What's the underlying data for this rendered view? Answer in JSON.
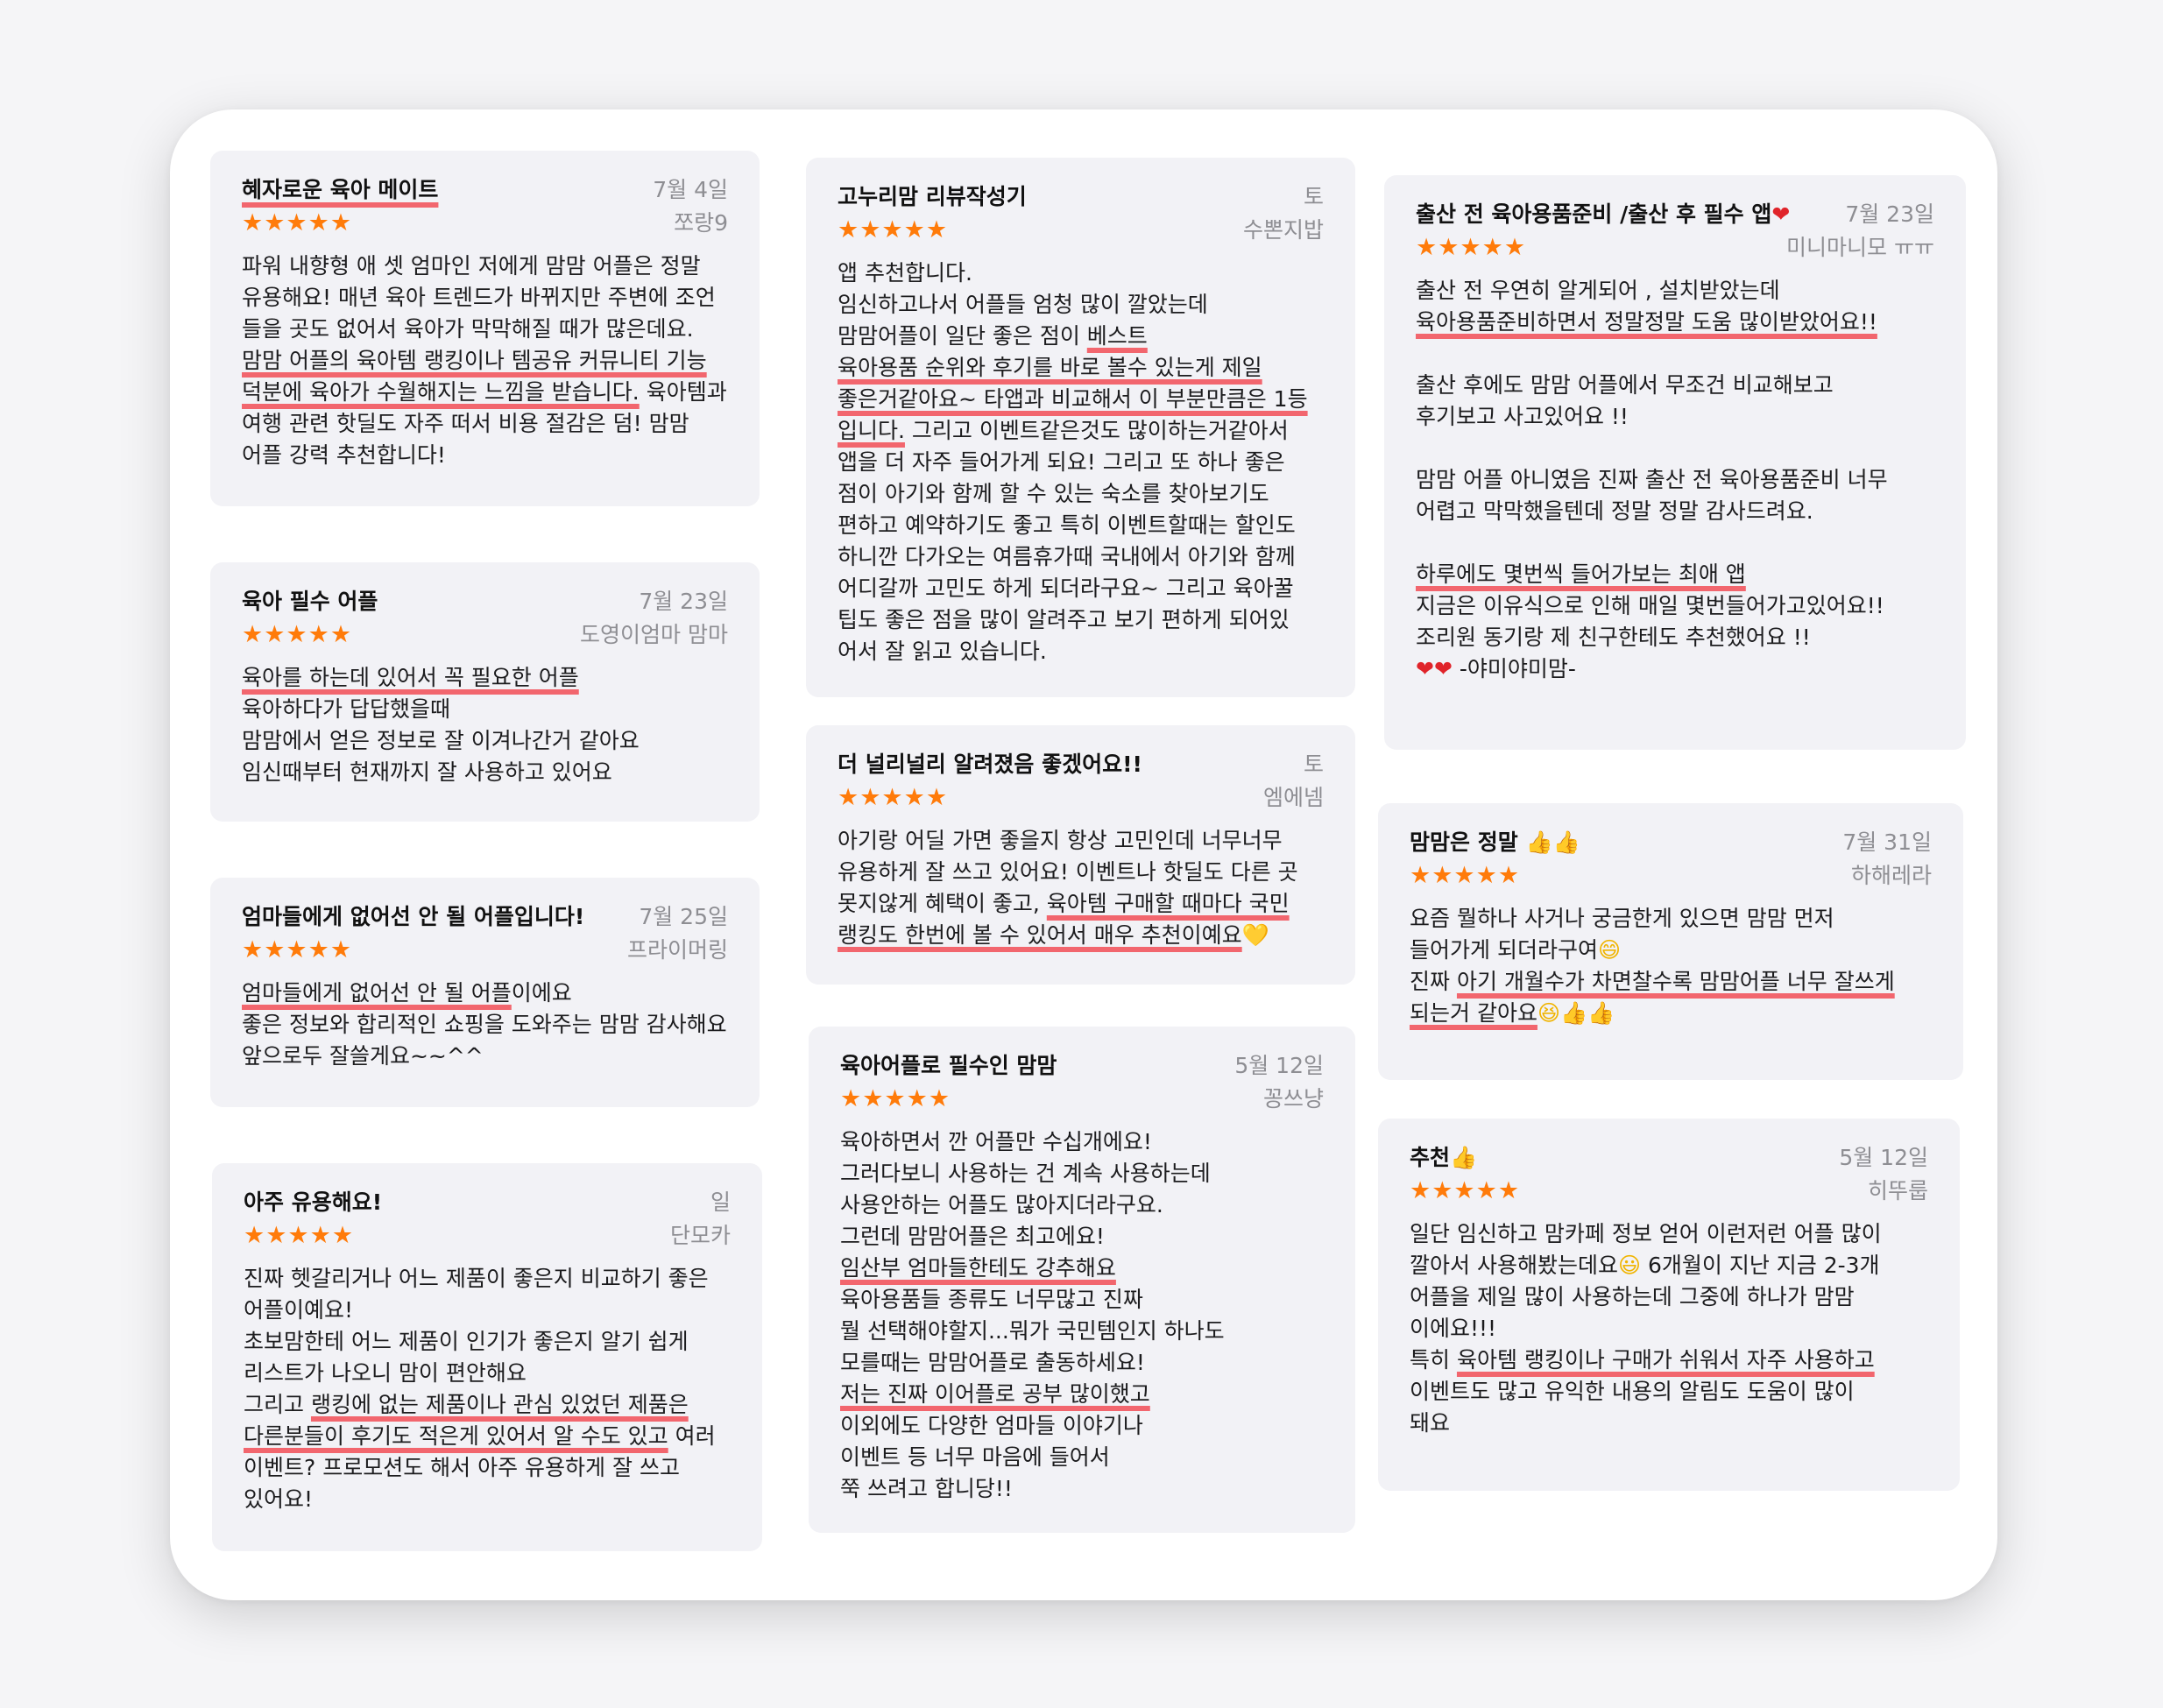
{
  "colors": {
    "star": "#ff7b0a",
    "highlight": "#f2666e",
    "card": "#f2f2f6",
    "muted": "#8e8e93"
  },
  "stars": "★★★★★",
  "reviews": [
    {
      "title": "혜자로운 육아 메이트",
      "date": "7월 4일",
      "author": "쪼랑9",
      "lines": [
        "파워 내향형 애 셋 엄마인 저에게 맘맘 어플은 정말",
        "유용해요! 매년 육아 트렌드가 바뀌지만 주변에 조언",
        "들을 곳도 없어서 육아가 막막해질 때가 많은데요.",
        "맘맘 어플의 육아템 랭킹이나 템공유 커뮤니티 기능",
        "덕분에 육아가 수월해지는 느낌을 받습니다.",
        " 육아템과",
        "여행 관련 핫딜도 자주 떠서 비용 절감은 덤! 맘맘",
        "어플 강력 추천합니다!"
      ]
    },
    {
      "title": "육아 필수 어플",
      "date": "7월 23일",
      "author": "도영이엄마 맘마",
      "lines": [
        "육아를 하는데 있어서 꼭 필요한 어플",
        "육아하다가 답답했을때",
        "맘맘에서 얻은 정보로 잘 이겨나간거 같아요",
        "임신때부터 현재까지 잘 사용하고 있어요"
      ]
    },
    {
      "title": "엄마들에게 없어선 안 될 어플입니다!",
      "date": "7월 25일",
      "author": "프라이머링",
      "lines": [
        "엄마들에게 없어선 안 될 어플",
        "이에요",
        "좋은 정보와 합리적인 쇼핑을 도와주는 맘맘 감사해요",
        "앞으로두 잘쓸게요~~^^"
      ]
    },
    {
      "title": "아주 유용해요!",
      "date": "일",
      "author": "단모카",
      "lines": [
        "진짜 헷갈리거나 어느 제품이 좋은지 비교하기 좋은",
        "어플이예요!",
        "초보맘한테 어느 제품이 인기가 좋은지 알기 쉽게",
        "리스트가 나오니 맘이 편안해요",
        "그리고 ",
        "랭킹에 없는 제품이나 관심 있었던 제품은",
        "다른분들이 후기도 적은게 있어서 알 수도 있고",
        " 여러",
        "이벤트? 프로모션도 해서 아주 유용하게 잘 쓰고",
        "있어요!"
      ]
    },
    {
      "title": "고누리맘 리뷰작성기",
      "date": "토",
      "author": "수뽄지밥",
      "lines": [
        "앱 추천합니다.",
        "임신하고나서 어플들 엄청 많이 깔았는데",
        "맘맘어플이 일단 좋은 점이 ",
        "베스트",
        "육아용품 순위와 후기를 바로 볼수 있는게 제일",
        "좋은거같아요~ 타앱과 비교해서 이 부분만큼은 1등",
        "입니다.",
        " 그리고 이벤트같은것도 많이하는거같아서",
        "앱을 더 자주 들어가게 되요! 그리고 또 하나 좋은",
        "점이 아기와 함께 할 수 있는 숙소를 찾아보기도",
        "편하고 예약하기도 좋고 특히 이벤트할때는 할인도",
        "하니깐 다가오는 여름휴가때 국내에서 아기와 함께",
        "어디갈까 고민도 하게 되더라구요~ 그리고 육아꿀",
        "팁도 좋은 점을 많이 알려주고 보기 편하게 되어있",
        "어서 잘 읽고 있습니다."
      ]
    },
    {
      "title": "더 널리널리 알려졌음 좋겠어요!!",
      "date": "토",
      "author": "엠에넴",
      "lines": [
        "아기랑 어딜 가면 좋을지 항상 고민인데 너무너무",
        "유용하게 잘 쓰고 있어요! 이벤트나 핫딜도 다른 곳",
        "못지않게 혜택이 좋고, ",
        "육아템 구매할 때마다 국민",
        "랭킹도 한번에 볼 수 있어서 매우 추천이예요",
        "💛"
      ]
    },
    {
      "title": "육아어플로 필수인 맘맘",
      "date": "5월 12일",
      "author": "꽁쓰냥",
      "lines": [
        "육아하면서 깐 어플만 수십개에요!",
        "그러다보니 사용하는 건 계속 사용하는데",
        "사용안하는 어플도 많아지더라구요.",
        "그런데 맘맘어플은 최고에요!",
        "임산부 엄마들한테도 강추해요",
        "육아용품들 종류도 너무많고 진짜",
        "뭘 선택해야할지...뭐가 국민템인지 하나도",
        "모를때는 맘맘어플로 출동하세요!",
        "저는 진짜 이어플로 공부 많이했고",
        "이외에도 다양한 엄마들 이야기나",
        "이벤트 등 너무 마음에 들어서",
        "쭉 쓰려고 합니당!!"
      ]
    },
    {
      "title": "출산 전 육아용품준비 /출산 후 필수 앱",
      "title_emoji": "❤",
      "date": "7월 23일",
      "author": "미니마니모 ㅠㅠ",
      "lines": [
        "출산 전 우연히 알게되어 , 설치받았는데",
        "육아용품준비하면서 정말정말 도움 많이받았어요!!",
        "",
        "출산 후에도  맘맘 어플에서 무조건 비교해보고",
        "후기보고 사고있어요 !!",
        "",
        "맘맘 어플 아니였음 진짜 출산 전 육아용품준비 너무",
        "어렵고 막막했을텐데 정말 정말 감사드려요.",
        "",
        "하루에도 몇번씩 들어가보는 최애 앱",
        "지금은 이유식으로 인해 매일 몇번들어가고있어요!!",
        "조리원 동기랑 제 친구한테도 추천했어요 !!",
        "❤❤",
        " -야미야미맘-"
      ]
    },
    {
      "title": "맘맘은 정말",
      "title_emoji": "👍👍",
      "date": "7월 31일",
      "author": "하해레라",
      "lines": [
        "요즘 뭘하나 사거나 궁금한게 있으면 맘맘 먼저",
        "들어가게 되더라구여",
        "😄",
        "진짜 ",
        "아기 개월수가 차면찰수록 맘맘어플 너무 잘쓰게",
        "되는거 같아요",
        "😆👍👍"
      ]
    },
    {
      "title": "추천",
      "title_emoji": "👍",
      "date": "5월 12일",
      "author": "히뚜룹",
      "lines": [
        "일단 임신하고 맘카페 정보 얻어 이런저런 어플 많이",
        "깔아서 사용해봤는데요",
        "😃",
        " 6개월이 지난 지금 2-3개",
        "어플을 제일 많이 사용하는데 그중에 하나가 맘맘",
        "이에요!!!",
        "특히 ",
        "육아템 랭킹이나 구매가 쉬워서 자주 사용하고",
        "이벤트도 많고 유익한 내용의 알림도 도움이 많이",
        "돼요"
      ]
    }
  ]
}
